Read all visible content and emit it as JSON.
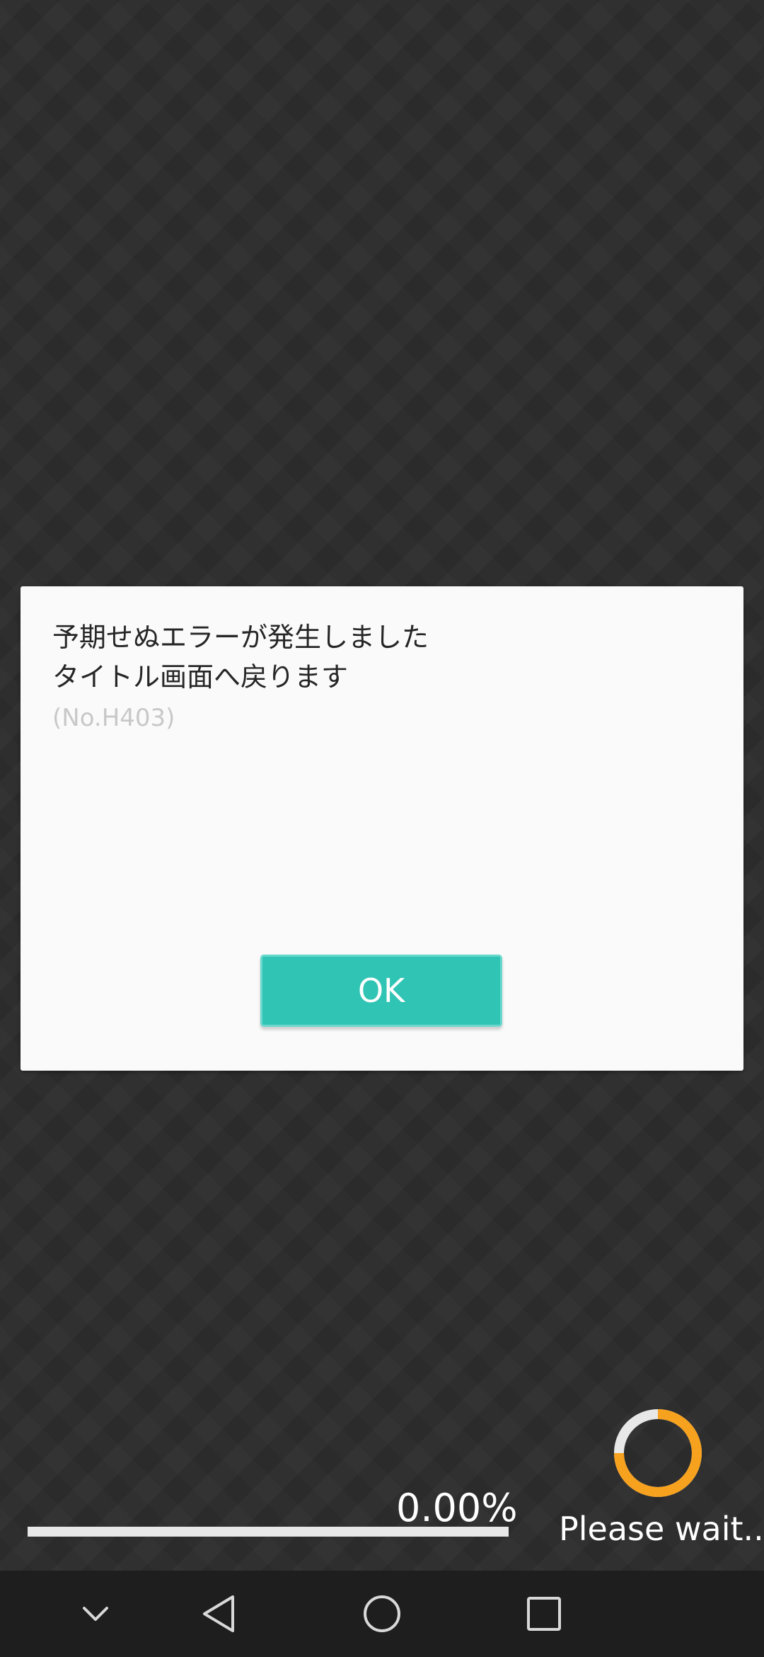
{
  "dialog": {
    "message_line1": "予期せぬエラーが発生しました",
    "message_line2": "タイトル画面へ戻ります",
    "error_code": "(No.H403)",
    "ok_label": "OK"
  },
  "loading": {
    "progress_text": "0.00%",
    "progress_fraction": 0.0,
    "wait_text": "Please wait..."
  },
  "navbar": {
    "icons": [
      "chevron-down-icon",
      "back-triangle-icon",
      "home-circle-icon",
      "recents-square-icon"
    ]
  },
  "colors": {
    "accent": "#30c4b4",
    "spinner": "#f7a21e",
    "spinner_track": "#e8e8e8",
    "background": "#2d2d2d",
    "navbar": "#1e1e1e"
  }
}
